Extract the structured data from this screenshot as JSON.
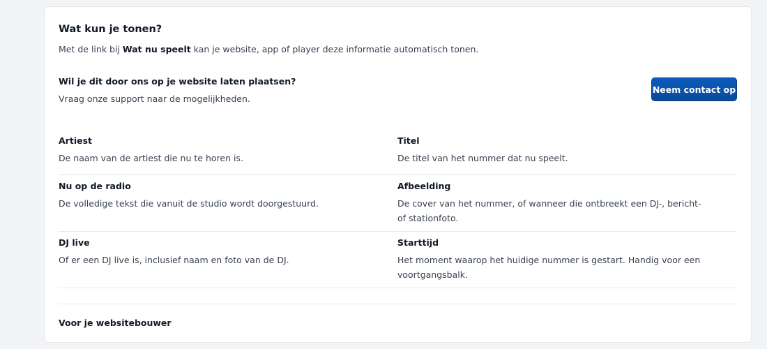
{
  "section": {
    "title": "Wat kun je tonen?",
    "intro_prefix": "Met de link bij ",
    "intro_bold": "Wat nu speelt",
    "intro_suffix": " kan je website, app of player deze informatie automatisch tonen."
  },
  "contact": {
    "question": "Wil je dit door ons op je website laten plaatsen?",
    "subtext": "Vraag onze support naar de mogelijkheden.",
    "button_label": "Neem contact op"
  },
  "fields": [
    {
      "label": "Artiest",
      "description": "De naam van de artiest die nu te horen is."
    },
    {
      "label": "Titel",
      "description": "De titel van het nummer dat nu speelt."
    },
    {
      "label": "Nu op de radio",
      "description": "De volledige tekst die vanuit de studio wordt doorgestuurd."
    },
    {
      "label": "Afbeelding",
      "description": "De cover van het nummer, of wanneer die ontbreekt een DJ-, bericht- of stationfoto."
    },
    {
      "label": "DJ live",
      "description": "Of er een DJ live is, inclusief naam en foto van de DJ."
    },
    {
      "label": "Starttijd",
      "description": "Het moment waarop het huidige nummer is gestart. Handig voor een voortgangsbalk."
    }
  ],
  "footer": {
    "builder_heading": "Voor je websitebouwer"
  },
  "colors": {
    "button": "#0a4a99",
    "card_bg": "#ffffff",
    "page_bg": "#f3f4f6"
  }
}
